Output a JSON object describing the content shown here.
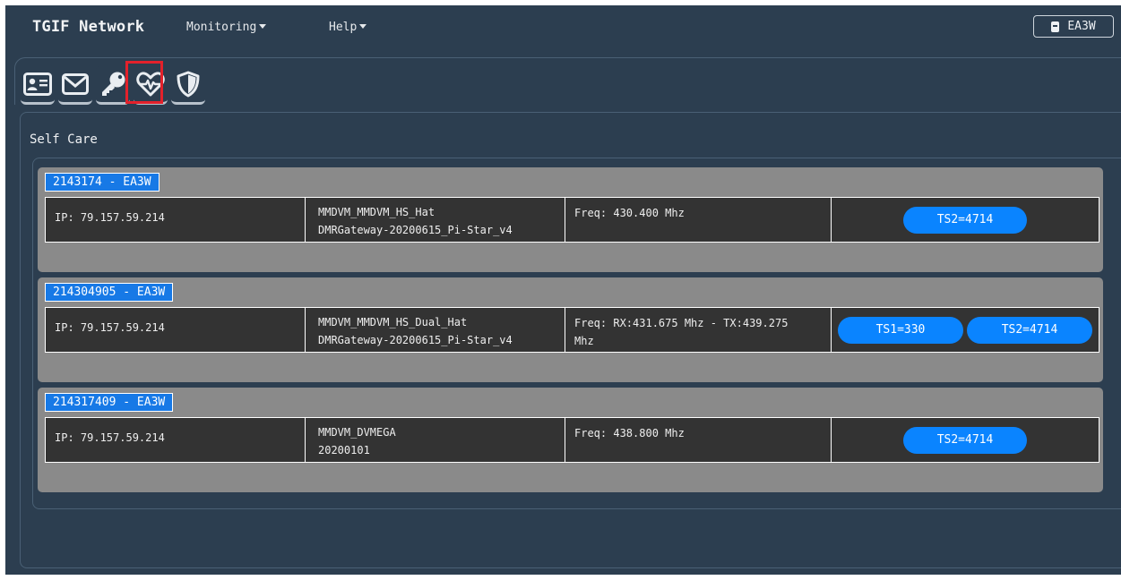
{
  "navbar": {
    "brand": "TGIF Network",
    "menu": [
      {
        "label": "Monitoring"
      },
      {
        "label": "Help"
      }
    ],
    "user": {
      "callsign": "EA3W"
    }
  },
  "tabs": [
    {
      "icon": "id-card-icon"
    },
    {
      "icon": "envelope-icon"
    },
    {
      "icon": "key-icon"
    },
    {
      "icon": "heartbeat-icon",
      "highlighted": true
    },
    {
      "icon": "shield-icon"
    }
  ],
  "colors": {
    "background": "#2c3e50",
    "hotspot_panel": "#8a8a8a",
    "tag": "#1779e6",
    "talkgroup_button": "#0a84ff",
    "highlight": "#e3212b"
  },
  "section": {
    "title": "Self Care"
  },
  "hotspots": [
    {
      "id_label": "2143174 - EA3W",
      "ip": "IP: 79.157.59.214",
      "model": "MMDVM_MMDVM_HS_Hat",
      "firmware": "DMRGateway-20200615_Pi-Star_v4",
      "freq_line1": "Freq: 430.400 Mhz",
      "freq_line2": "",
      "talkgroups": [
        "TS2=4714"
      ]
    },
    {
      "id_label": "214304905 - EA3W",
      "ip": "IP: 79.157.59.214",
      "model": "MMDVM_MMDVM_HS_Dual_Hat",
      "firmware": "DMRGateway-20200615_Pi-Star_v4",
      "freq_line1": "Freq: RX:431.675 Mhz - TX:439.275",
      "freq_line2": "Mhz",
      "talkgroups": [
        "TS1=330",
        "TS2=4714"
      ]
    },
    {
      "id_label": "214317409 - EA3W",
      "ip": "IP: 79.157.59.214",
      "model": "MMDVM_DVMEGA",
      "firmware": "20200101",
      "freq_line1": "Freq: 438.800 Mhz",
      "freq_line2": "",
      "talkgroups": [
        "TS2=4714"
      ]
    }
  ]
}
